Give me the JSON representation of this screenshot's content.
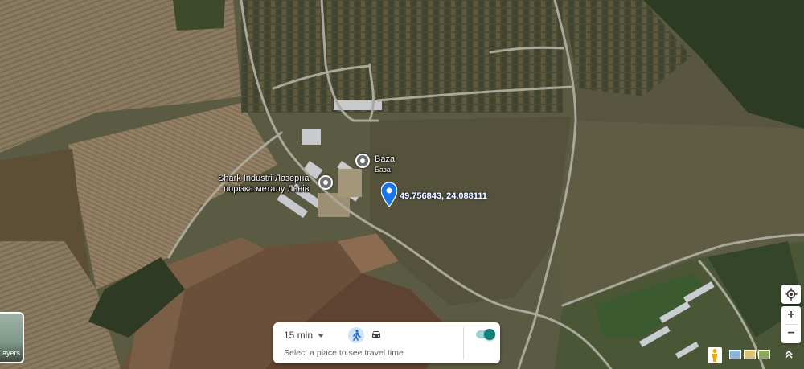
{
  "places": [
    {
      "name": "Baza",
      "subtitle": "База"
    },
    {
      "name_line1": "Shark Industri Лазерна",
      "name_line2": "порізка металу Львів"
    }
  ],
  "dropped_pin": {
    "coordinates": "49.756843, 24.088111",
    "color": "#1a73e8"
  },
  "travel_card": {
    "time_label": "15 min",
    "hint": "Select a place to see travel time",
    "walk_icon": "walking-icon",
    "car_icon": "car-icon",
    "toggle_state": "on",
    "accent": "#10807a"
  },
  "layers_button": {
    "label": "Layers"
  },
  "controls": {
    "locate_icon": "my-location-icon",
    "zoom_in": "+",
    "zoom_out": "−",
    "pegman_icon": "pegman-icon",
    "expand_icon": "chevron-up-icon"
  }
}
